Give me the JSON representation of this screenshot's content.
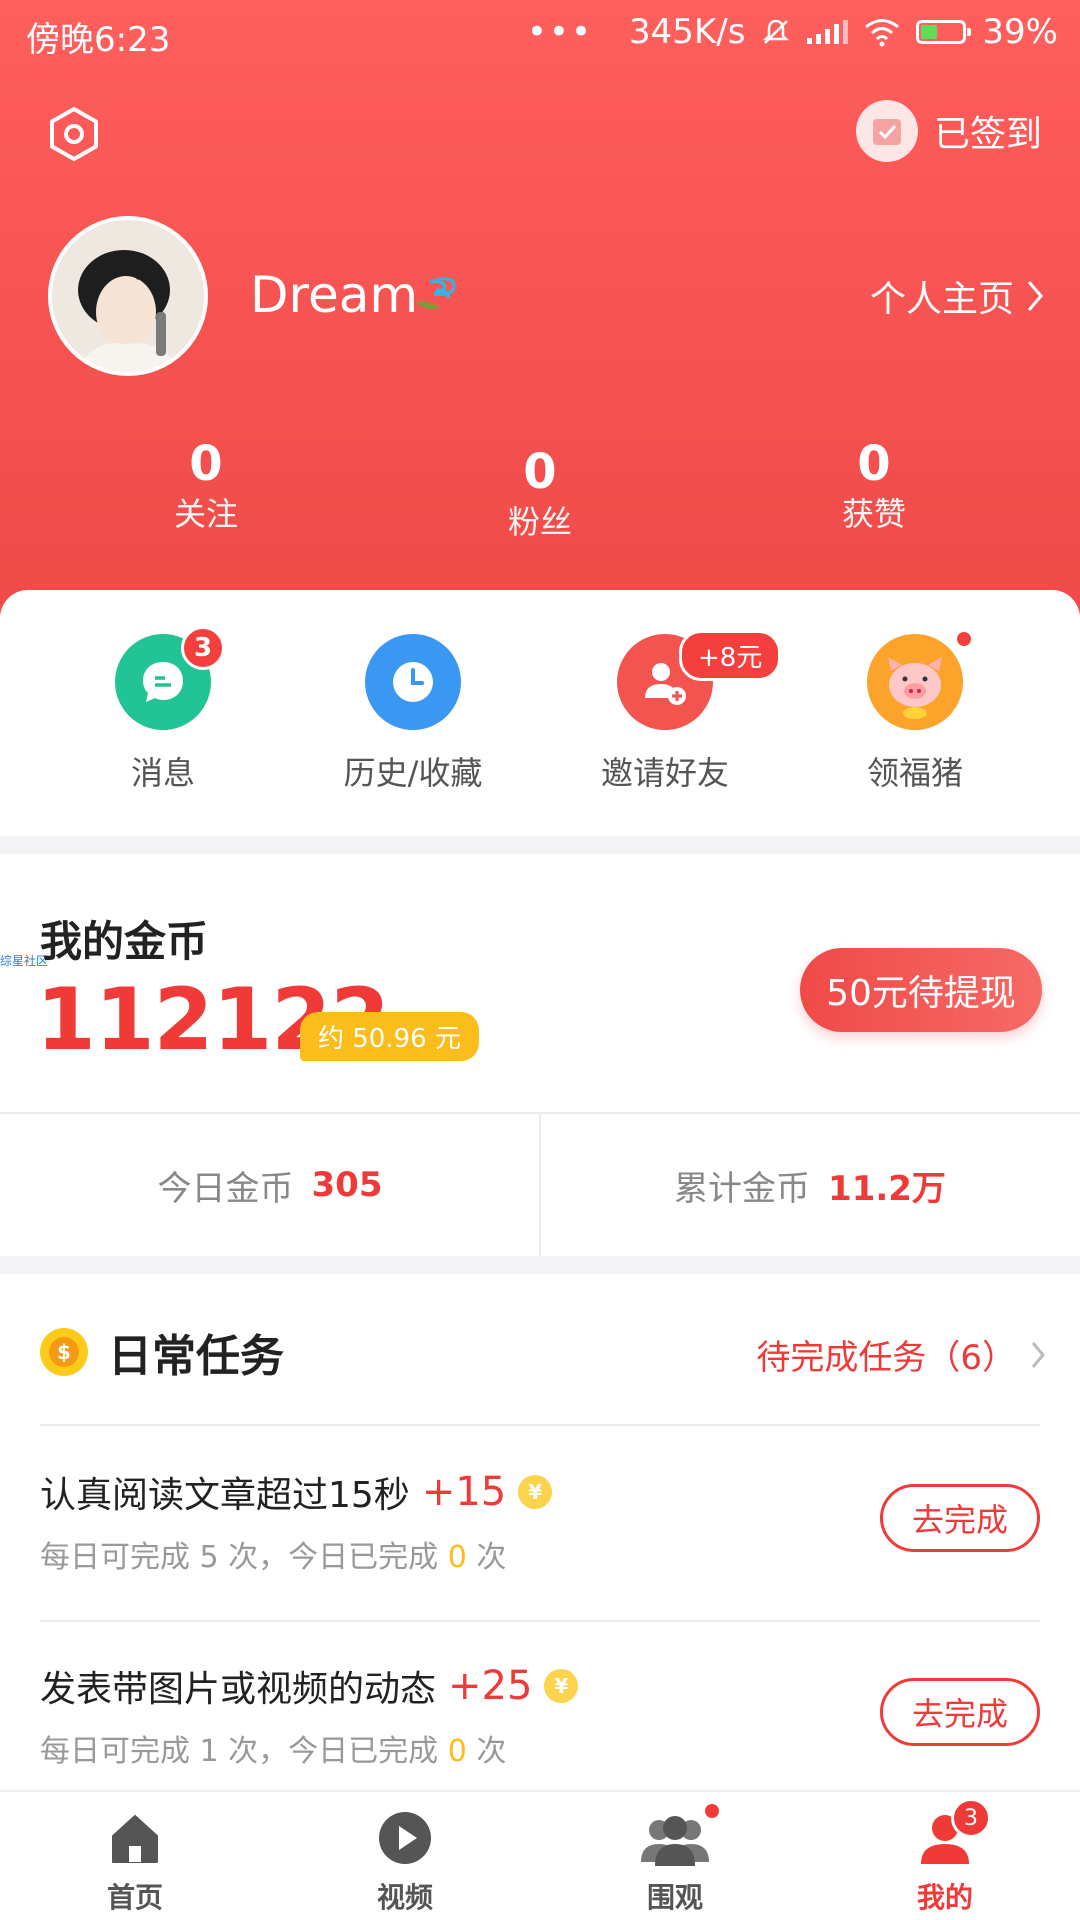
{
  "status_bar": {
    "time": "傍晚6:23",
    "dots": "•••",
    "speed": "345K/s",
    "battery": "39%",
    "battery_level": 0.39
  },
  "header": {
    "signed_label": "已签到",
    "username": "Dream",
    "profile_link": "个人主页",
    "stats": [
      {
        "value": "0",
        "label": "关注"
      },
      {
        "value": "0",
        "label": "粉丝"
      },
      {
        "value": "0",
        "label": "获赞"
      }
    ]
  },
  "quick_actions": [
    {
      "label": "消息",
      "badge": "3",
      "color": "#22c495",
      "icon": "message-icon"
    },
    {
      "label": "历史/收藏",
      "color": "#3a97f2",
      "icon": "clock-icon"
    },
    {
      "label": "邀请好友",
      "reward": "+8元",
      "color": "#f3544f",
      "icon": "invite-user-icon"
    },
    {
      "label": "领福猪",
      "color": "#fba32a",
      "icon": "pig-icon"
    }
  ],
  "coins": {
    "title": "我的金币",
    "value": "112122",
    "approx": "约 50.96 元",
    "withdraw_label": "50元待提现",
    "today_label": "今日金币",
    "today_value": "305",
    "total_label": "累计金币",
    "total_value": "11.2万"
  },
  "watermark": "综星社区",
  "tasks": {
    "title": "日常任务",
    "pending": "待完成任务（6）",
    "items": [
      {
        "title": "认真阅读文章超过15秒",
        "reward": "+15",
        "sub_prefix": "每日可完成 5 次，今日已完成 ",
        "done": "0",
        "sub_suffix": " 次",
        "button": "去完成"
      },
      {
        "title": "发表带图片或视频的动态",
        "reward": "+25",
        "sub_prefix": "每日可完成 1 次，今日已完成 ",
        "done": "0",
        "sub_suffix": " 次",
        "button": "去完成"
      }
    ]
  },
  "tabbar": [
    {
      "label": "首页",
      "icon": "home-icon"
    },
    {
      "label": "视频",
      "icon": "play-icon"
    },
    {
      "label": "围观",
      "icon": "group-icon"
    },
    {
      "label": "我的",
      "icon": "user-icon",
      "badge": "3",
      "active": true
    }
  ],
  "colors": {
    "brand_red": "#ef3a38",
    "gold": "#fbbd1c"
  }
}
